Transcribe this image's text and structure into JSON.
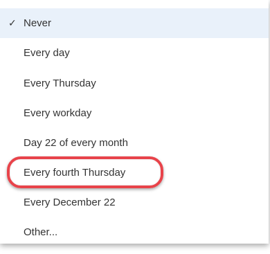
{
  "menu": {
    "items": [
      {
        "label": "Never",
        "selected": true,
        "check": "✓"
      },
      {
        "label": "Every day"
      },
      {
        "label": "Every Thursday"
      },
      {
        "label": "Every workday"
      },
      {
        "label": "Day 22 of every month"
      },
      {
        "label": "Every fourth Thursday",
        "highlighted": true
      },
      {
        "label": "Every December 22"
      },
      {
        "label": "Other..."
      }
    ]
  },
  "colors": {
    "selected_bg": "#e9f1fa",
    "highlight_ring": "#e8434a",
    "text": "#333333"
  }
}
